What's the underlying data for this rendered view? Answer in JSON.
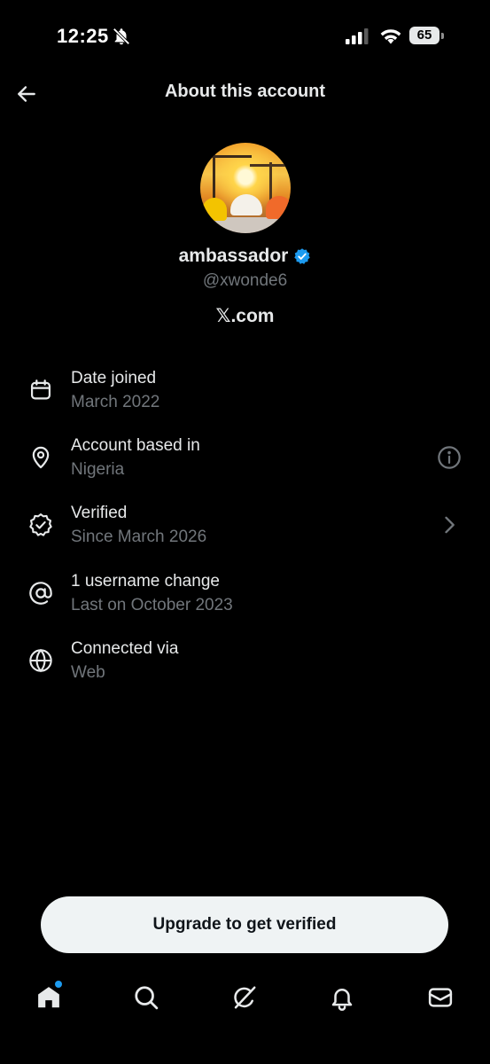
{
  "status_bar": {
    "time": "12:25",
    "battery": "65",
    "icons": [
      "bell-off-icon",
      "cellular-signal-icon",
      "wifi-icon",
      "battery-icon"
    ]
  },
  "header": {
    "title": "About this account",
    "back_icon": "arrow-left-icon"
  },
  "profile": {
    "display_name": "ambassador",
    "handle": "@xwonde6",
    "site": "𝕏.com",
    "verified_badge_color": "#1d9bf0"
  },
  "info": [
    {
      "icon": "calendar-icon",
      "title": "Date joined",
      "subtitle": "March 2022",
      "action": ""
    },
    {
      "icon": "location-pin-icon",
      "title": "Account based in",
      "subtitle": "Nigeria",
      "action": "info-icon"
    },
    {
      "icon": "verified-outline-icon",
      "title": "Verified",
      "subtitle": "Since March 2026",
      "action": "chevron-right-icon"
    },
    {
      "icon": "at-sign-icon",
      "title": "1 username change",
      "subtitle": "Last on October 2023",
      "action": ""
    },
    {
      "icon": "globe-icon",
      "title": "Connected via",
      "subtitle": "Web",
      "action": ""
    }
  ],
  "upgrade_button": {
    "label": "Upgrade to get verified"
  },
  "bottom_nav": {
    "items": [
      "home-icon",
      "search-icon",
      "grok-icon",
      "bell-icon",
      "mail-icon"
    ],
    "home_has_notification_dot": true,
    "dot_color": "#1d9bf0"
  },
  "colors": {
    "background": "#000000",
    "text_primary": "#e7e9ea",
    "text_secondary": "#71767b",
    "accent": "#1d9bf0",
    "button_bg": "#eff3f4"
  }
}
